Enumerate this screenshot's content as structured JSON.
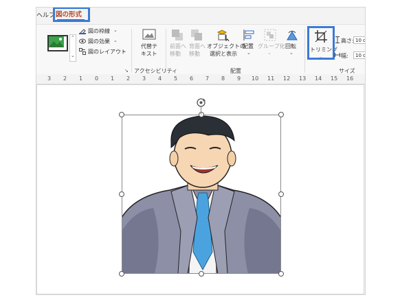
{
  "tabs": {
    "help": "ヘルプ",
    "picture_format": "図の形式"
  },
  "ribbon": {
    "border_label": "図の枠線",
    "effects_label": "図の効果",
    "layout_label": "図のレイアウト",
    "accessibility_group": "アクセシビリティ",
    "alt_text_line1": "代替テ",
    "alt_text_line2": "キスト",
    "bring_forward_line1": "前面へ",
    "bring_forward_line2": "移動",
    "send_backward_line1": "背面へ",
    "send_backward_line2": "移動",
    "selection_pane_line1": "オブジェクトの",
    "selection_pane_line2": "選択と表示",
    "align_label": "配置",
    "group_label": "グループ化",
    "rotate_label": "回転",
    "arrange_group": "配置",
    "crop_label": "トリミング",
    "height_label": "高さ:",
    "height_value": "10 c",
    "width_label": "幅:",
    "width_value": "10 c",
    "size_group": "サイズ"
  },
  "ruler": {
    "labels": [
      "3",
      "2",
      "1",
      "0",
      "1",
      "2",
      "3",
      "4",
      "5",
      "6",
      "7",
      "8",
      "9",
      "10",
      "11",
      "12",
      "13",
      "14",
      "15",
      "16"
    ]
  },
  "colors": {
    "accent": "#b7472a",
    "highlight": "#3a7bd5"
  }
}
